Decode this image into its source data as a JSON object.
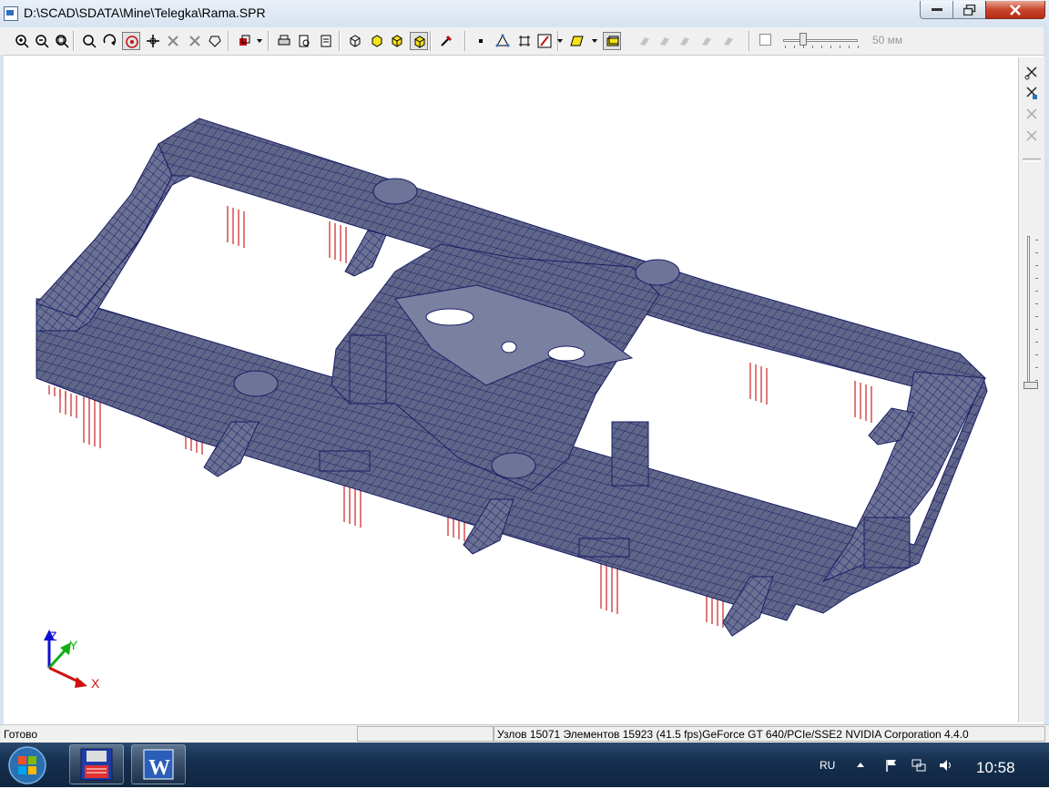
{
  "window": {
    "title": "D:\\SCAD\\SDATA\\Mine\\Telegka\\Rama.SPR"
  },
  "toolbar": {
    "buttons": [
      "zoom-in-icon",
      "zoom-out-icon",
      "zoom-window-icon",
      "zoom-all-icon",
      "rotate-icon",
      "select-icon",
      "pan-icon",
      "move-icon",
      "orbit-icon",
      "view-box-icon",
      "projection-icon",
      "print-icon",
      "print-preview-icon",
      "export-icon",
      "wireframe-icon",
      "shaded-icon",
      "solid-icon",
      "solid-color-icon",
      "tools-icon",
      "node-icon",
      "triangle-icon",
      "grid-icon",
      "line-color-icon",
      "fill-color-icon",
      "frame-icon"
    ],
    "slider_value": "50 мм"
  },
  "axes": {
    "x": "X",
    "y": "Y",
    "z": "Z"
  },
  "status": {
    "left": "Готово",
    "right": "Узлов 15071  Элементов 15923  (41.5 fps)GeForce GT 640/PCIe/SSE2 NVIDIA Corporation 4.4.0"
  },
  "taskbar": {
    "language": "RU",
    "clock": "10:58",
    "apps": [
      "scad-icon",
      "word-icon"
    ]
  },
  "colors": {
    "mesh_fill": "#5f6688",
    "mesh_line": "#1b1e66",
    "support": "#cc2020"
  }
}
